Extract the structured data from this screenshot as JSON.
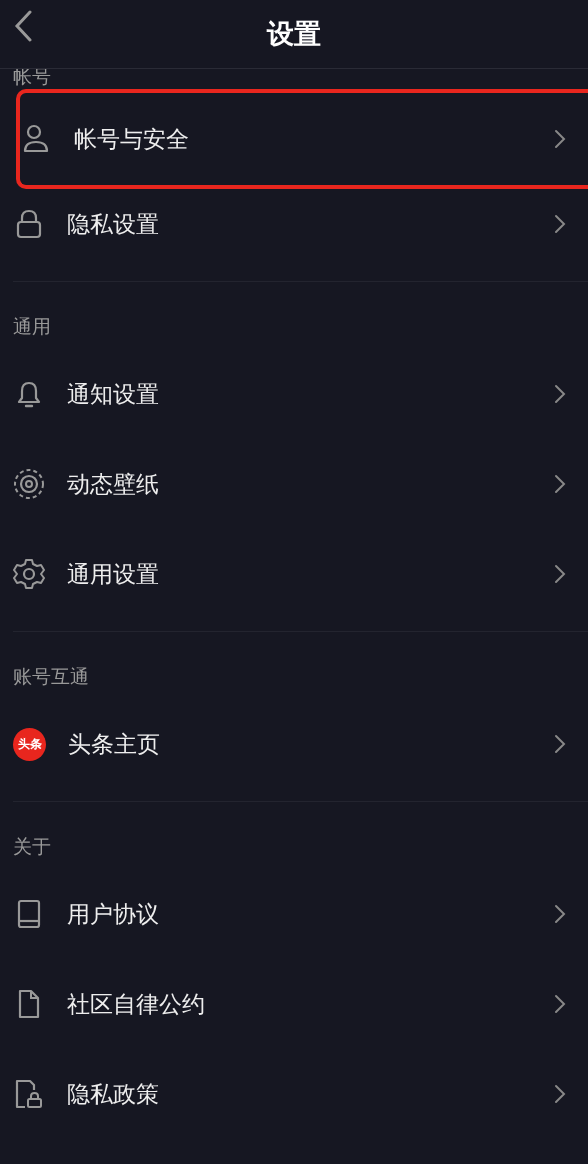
{
  "header": {
    "title": "设置"
  },
  "sections": [
    {
      "label": "帐号",
      "items": [
        {
          "label": "帐号与安全",
          "kind": "person",
          "highlighted": true
        },
        {
          "label": "隐私设置",
          "kind": "lock",
          "highlighted": false
        }
      ]
    },
    {
      "label": "通用",
      "items": [
        {
          "label": "通知设置",
          "kind": "bell",
          "highlighted": false
        },
        {
          "label": "动态壁纸",
          "kind": "wallpaper",
          "highlighted": false
        },
        {
          "label": "通用设置",
          "kind": "gear",
          "highlighted": false
        }
      ]
    },
    {
      "label": "账号互通",
      "items": [
        {
          "label": "头条主页",
          "kind": "logo",
          "logo_text": "头条",
          "highlighted": false
        }
      ]
    },
    {
      "label": "关于",
      "items": [
        {
          "label": "用户协议",
          "kind": "book",
          "highlighted": false
        },
        {
          "label": "社区自律公约",
          "kind": "document",
          "highlighted": false
        },
        {
          "label": "隐私政策",
          "kind": "doclock",
          "highlighted": false
        }
      ]
    }
  ]
}
